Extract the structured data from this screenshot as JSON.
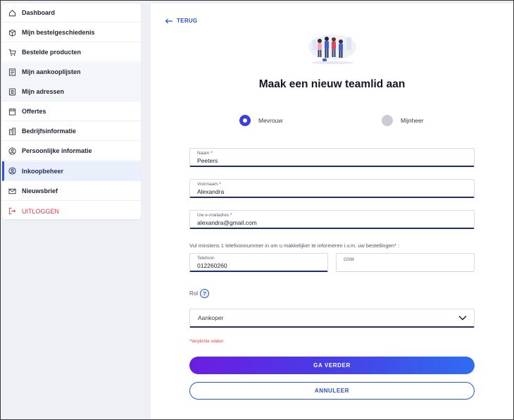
{
  "sidebar": {
    "items": [
      {
        "label": "Dashboard",
        "icon": "home-icon"
      },
      {
        "label": "Mijn bestelgeschiedenis",
        "icon": "box-icon"
      },
      {
        "label": "Bestelde producten",
        "icon": "cart-icon"
      },
      {
        "label": "Mijn aankooplijsten",
        "icon": "list-icon"
      },
      {
        "label": "Mijn adressen",
        "icon": "address-icon"
      },
      {
        "label": "Offertes",
        "icon": "calendar-icon"
      },
      {
        "label": "Bedrijfsinformatie",
        "icon": "building-icon"
      },
      {
        "label": "Persoonlijke informatie",
        "icon": "user-circle-icon"
      },
      {
        "label": "Inkoopbeheer",
        "icon": "user-circle-icon"
      },
      {
        "label": "Nieuwsbrief",
        "icon": "mail-icon"
      },
      {
        "label": "UITLOGGEN",
        "icon": "logout-icon"
      }
    ],
    "active_index": 8
  },
  "main": {
    "back_label": "TERUG",
    "title": "Maak een nieuw teamlid aan",
    "gender": {
      "options": [
        "Mevrouw",
        "Mijnheer"
      ],
      "selected": "Mevrouw"
    },
    "fields": {
      "naam": {
        "label": "Naam *",
        "value": "Peeters"
      },
      "voornaam": {
        "label": "Voornaam *",
        "value": "Alexandra"
      },
      "email": {
        "label": "Uw e-mailadres *",
        "value": "alexandra@gmail.com"
      },
      "telefoon": {
        "label": "Telefoon",
        "value": "012260260"
      },
      "gsm": {
        "label": "GSM",
        "value": ""
      }
    },
    "phone_hint": "Vul minstens 1 telefoonnummer in om u makkelijker te informeren i.v.m. uw bestellingen* :",
    "role": {
      "label": "Rol",
      "help": "?",
      "selected": "Aankoper"
    },
    "required_note": "*Verplichte velden",
    "buttons": {
      "continue": "GA VERDER",
      "cancel": "ANNULEER"
    }
  },
  "colors": {
    "accent": "#2a55d9",
    "radio_on": "#3b3fe0",
    "danger": "#e23c46",
    "gradient_start": "#6b1de0",
    "gradient_end": "#2f6cf0"
  }
}
